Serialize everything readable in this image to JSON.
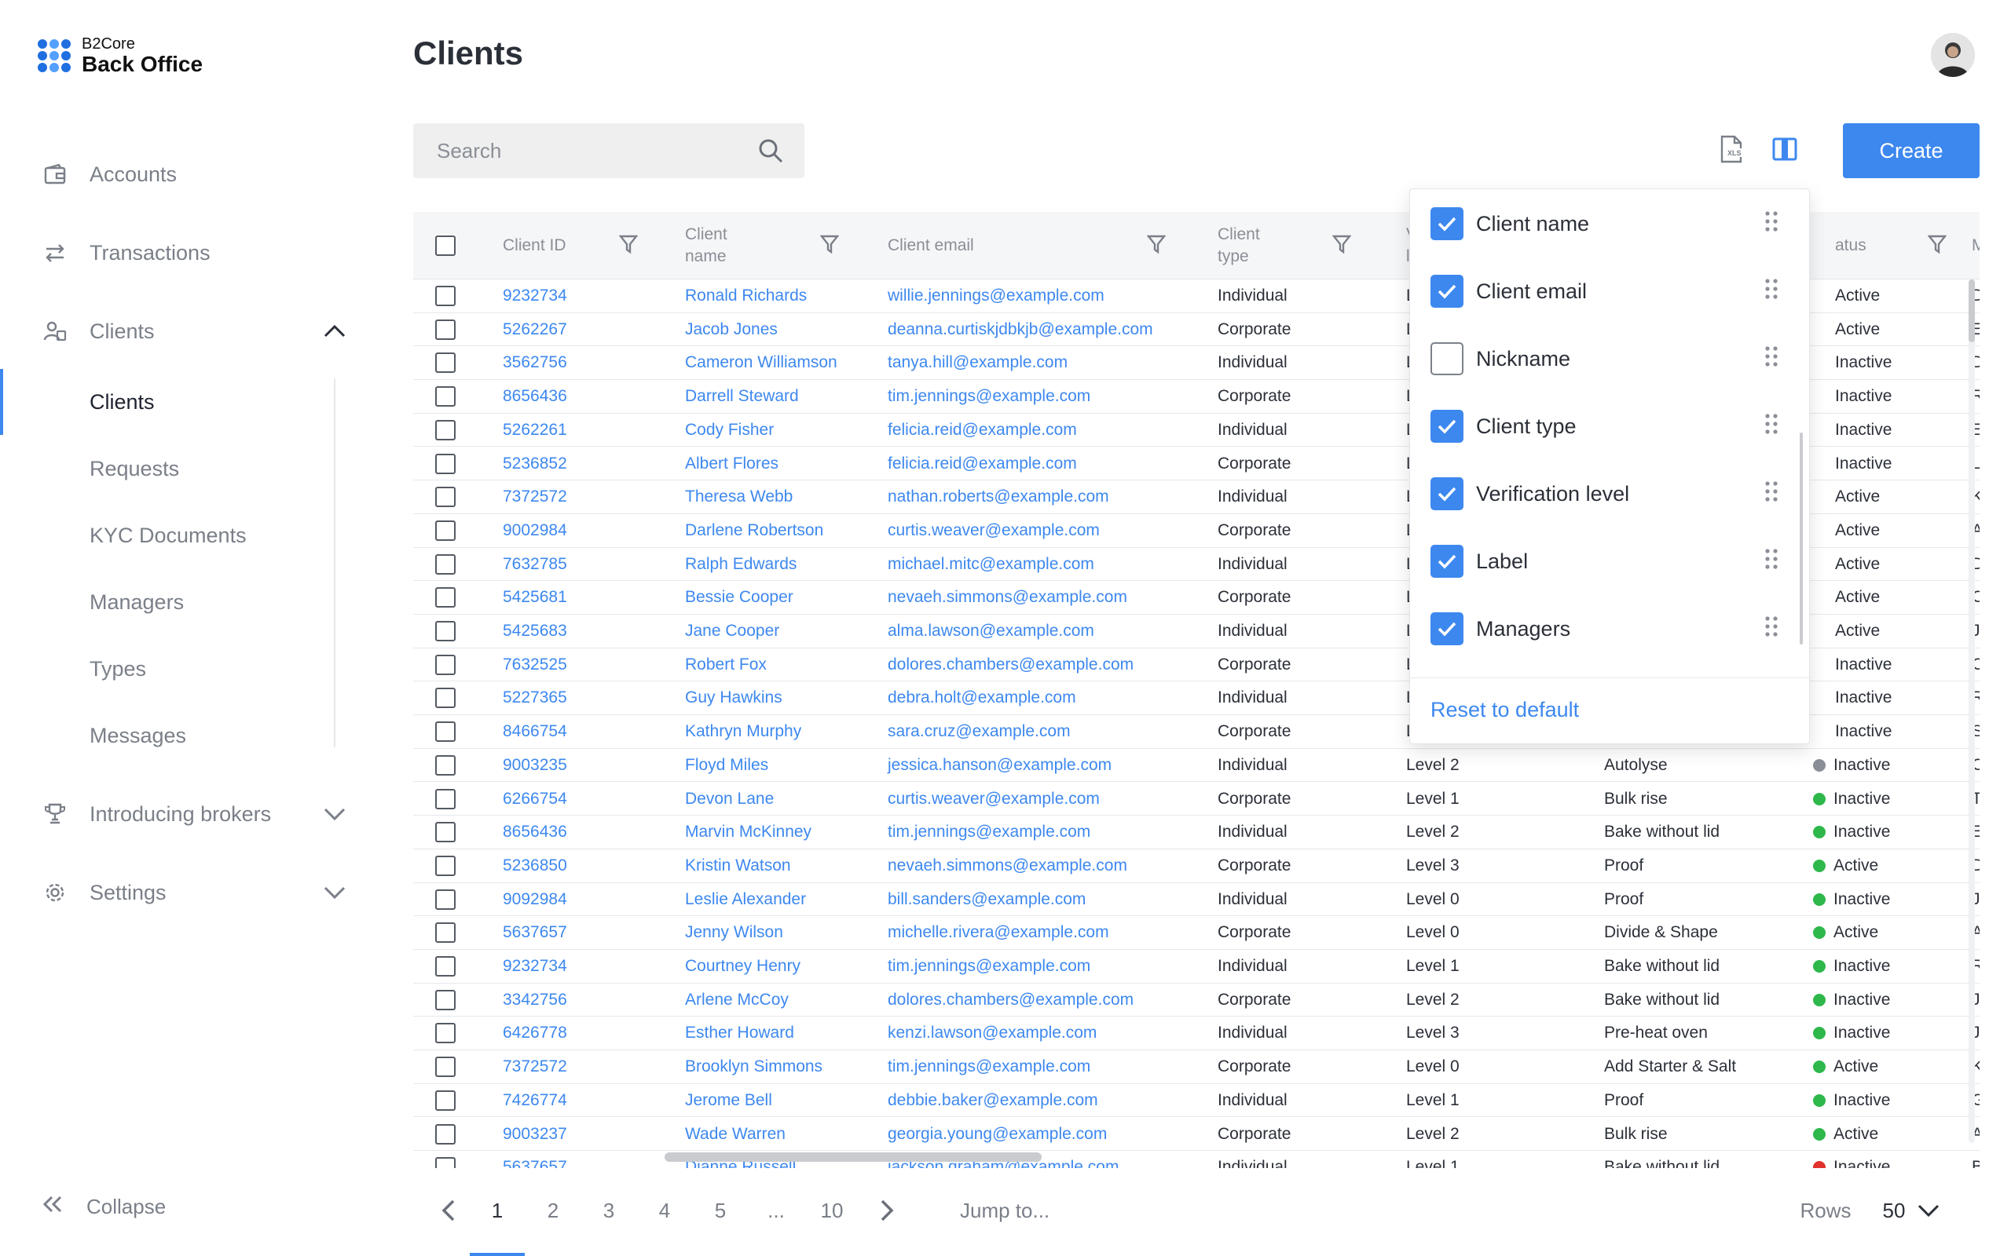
{
  "brand": {
    "line1": "B2Core",
    "line2": "Back Office"
  },
  "sidebar": {
    "nav": [
      {
        "label": "Accounts",
        "icon": "wallet-icon"
      },
      {
        "label": "Transactions",
        "icon": "transfer-arrows-icon"
      },
      {
        "label": "Clients",
        "icon": "users-icon"
      },
      {
        "label": "Introducing brokers",
        "icon": "trophy-icon"
      },
      {
        "label": "Settings",
        "icon": "gear-icon"
      }
    ],
    "clients_sub": [
      "Clients",
      "Requests",
      "KYC Documents",
      "Managers",
      "Types",
      "Messages"
    ],
    "collapse_label": "Collapse"
  },
  "page": {
    "title": "Clients"
  },
  "toolbar": {
    "search_placeholder": "Search",
    "create_label": "Create"
  },
  "table": {
    "headers": {
      "client_id": "Client ID",
      "client_name": [
        "Client",
        "name"
      ],
      "client_email": "Client email",
      "client_type": [
        "Client",
        "type"
      ],
      "verification": [
        "V",
        "le"
      ],
      "status": "atus",
      "managers": "Ma"
    },
    "rows": [
      {
        "id": "9232734",
        "name": "Ronald Richards",
        "email": "willie.jennings@example.com",
        "type": "Individual",
        "level": "L",
        "label": "",
        "status": "Active",
        "mgr": "Da"
      },
      {
        "id": "5262267",
        "name": "Jacob Jones",
        "email": "deanna.curtiskjdbkjb@example.com",
        "type": "Corporate",
        "level": "L",
        "label": "",
        "status": "Active",
        "mgr": "El"
      },
      {
        "id": "3562756",
        "name": "Cameron Williamson",
        "email": "tanya.hill@example.com",
        "type": "Individual",
        "level": "L",
        "label": "",
        "status": "Inactive",
        "mgr": "De"
      },
      {
        "id": "8656436",
        "name": "Darrell Steward",
        "email": "tim.jennings@example.com",
        "type": "Corporate",
        "level": "L",
        "label": "",
        "status": "Inactive",
        "mgr": "Ro"
      },
      {
        "id": "5262261",
        "name": "Cody Fisher",
        "email": "felicia.reid@example.com",
        "type": "Individual",
        "level": "L",
        "label": "",
        "status": "Inactive",
        "mgr": "Ei"
      },
      {
        "id": "5236852",
        "name": "Albert Flores",
        "email": "felicia.reid@example.com",
        "type": "Corporate",
        "level": "L",
        "label": "",
        "status": "Inactive",
        "mgr": "Le"
      },
      {
        "id": "7372572",
        "name": "Theresa Webb",
        "email": "nathan.roberts@example.com",
        "type": "Individual",
        "level": "L",
        "label": "",
        "status": "Active",
        "mgr": "Kr"
      },
      {
        "id": "9002984",
        "name": "Darlene Robertson",
        "email": "curtis.weaver@example.com",
        "type": "Corporate",
        "level": "L",
        "label": "",
        "status": "Active",
        "mgr": "Al"
      },
      {
        "id": "7632785",
        "name": "Ralph Edwards",
        "email": "michael.mitc@example.com",
        "type": "Individual",
        "level": "L",
        "label": "",
        "status": "Active",
        "mgr": "Da"
      },
      {
        "id": "5425681",
        "name": "Bessie Cooper",
        "email": "nevaeh.simmons@example.com",
        "type": "Corporate",
        "level": "L",
        "label": "",
        "status": "Active",
        "mgr": "Ca"
      },
      {
        "id": "5425683",
        "name": "Jane Cooper",
        "email": "alma.lawson@example.com",
        "type": "Individual",
        "level": "L",
        "label": "",
        "status": "Active",
        "mgr": "Je"
      },
      {
        "id": "7632525",
        "name": "Robert Fox",
        "email": "dolores.chambers@example.com",
        "type": "Corporate",
        "level": "L",
        "label": "",
        "status": "Inactive",
        "mgr": "Co"
      },
      {
        "id": "5227365",
        "name": "Guy Hawkins",
        "email": "debra.holt@example.com",
        "type": "Individual",
        "level": "L",
        "label": "",
        "status": "Inactive",
        "mgr": "Ra"
      },
      {
        "id": "8466754",
        "name": "Kathryn Murphy",
        "email": "sara.cruz@example.com",
        "type": "Corporate",
        "level": "L",
        "label": "",
        "status": "Inactive",
        "mgr": "Sa"
      },
      {
        "id": "9003235",
        "name": "Floyd Miles",
        "email": "jessica.hanson@example.com",
        "type": "Individual",
        "level": "Level 2",
        "label": "Autolyse",
        "status": "Inactive",
        "mgr": "Ca",
        "dot": "#8a8e96"
      },
      {
        "id": "6266754",
        "name": "Devon Lane",
        "email": "curtis.weaver@example.com",
        "type": "Corporate",
        "level": "Level 1",
        "label": "Bulk rise",
        "status": "Inactive",
        "mgr": "Th",
        "dot": "#2eb84b"
      },
      {
        "id": "8656436",
        "name": "Marvin McKinney",
        "email": "tim.jennings@example.com",
        "type": "Individual",
        "level": "Level 2",
        "label": "Bake without lid",
        "status": "Inactive",
        "mgr": "Es",
        "dot": "#2eb84b"
      },
      {
        "id": "5236850",
        "name": "Kristin Watson",
        "email": "nevaeh.simmons@example.com",
        "type": "Corporate",
        "level": "Level 3",
        "label": "Proof",
        "status": "Active",
        "mgr": "Di",
        "dot": "#2eb84b"
      },
      {
        "id": "9092984",
        "name": "Leslie Alexander",
        "email": "bill.sanders@example.com",
        "type": "Individual",
        "level": "Level 0",
        "label": "Proof",
        "status": "Inactive",
        "mgr": "Ja",
        "dot": "#2eb84b"
      },
      {
        "id": "5637657",
        "name": "Jenny Wilson",
        "email": "michelle.rivera@example.com",
        "type": "Corporate",
        "level": "Level 0",
        "label": "Divide & Shape",
        "status": "Active",
        "mgr": "Ar",
        "dot": "#2eb84b"
      },
      {
        "id": "9232734",
        "name": "Courtney Henry",
        "email": "tim.jennings@example.com",
        "type": "Individual",
        "level": "Level 1",
        "label": "Bake without lid",
        "status": "Inactive",
        "mgr": "Ro",
        "dot": "#2eb84b"
      },
      {
        "id": "3342756",
        "name": "Arlene McCoy",
        "email": "dolores.chambers@example.com",
        "type": "Corporate",
        "level": "Level 2",
        "label": "Bake without lid",
        "status": "Inactive",
        "mgr": "Je",
        "dot": "#2eb84b"
      },
      {
        "id": "6426778",
        "name": "Esther Howard",
        "email": "kenzi.lawson@example.com",
        "type": "Individual",
        "level": "Level 3",
        "label": "Pre-heat oven",
        "status": "Inactive",
        "mgr": "Ja",
        "dot": "#2eb84b"
      },
      {
        "id": "7372572",
        "name": "Brooklyn Simmons",
        "email": "tim.jennings@example.com",
        "type": "Corporate",
        "level": "Level 0",
        "label": "Add Starter & Salt",
        "status": "Active",
        "mgr": "Ka",
        "dot": "#2eb84b"
      },
      {
        "id": "7426774",
        "name": "Jerome Bell",
        "email": "debbie.baker@example.com",
        "type": "Individual",
        "level": "Level 1",
        "label": "Proof",
        "status": "Inactive",
        "mgr": "Gu",
        "dot": "#2eb84b"
      },
      {
        "id": "9003237",
        "name": "Wade Warren",
        "email": "georgia.young@example.com",
        "type": "Corporate",
        "level": "Level 2",
        "label": "Bulk rise",
        "status": "Active",
        "mgr": "Ar",
        "dot": "#2eb84b"
      },
      {
        "id": "5637657",
        "name": "Dianne Russell",
        "email": "jackson.graham@example.com",
        "type": "Individual",
        "level": "Level 1",
        "label": "Bake without lid",
        "status": "Inactive",
        "mgr": "Bo",
        "dot": "#e0322d"
      }
    ]
  },
  "columns_popup": {
    "items": [
      {
        "label": "Client name",
        "checked": true
      },
      {
        "label": "Client email",
        "checked": true
      },
      {
        "label": "Nickname",
        "checked": false
      },
      {
        "label": "Client type",
        "checked": true
      },
      {
        "label": "Verification level",
        "checked": true
      },
      {
        "label": "Label",
        "checked": true
      },
      {
        "label": "Managers",
        "checked": true
      }
    ],
    "reset_label": "Reset to default"
  },
  "pagination": {
    "pages": [
      "1",
      "2",
      "3",
      "4",
      "5",
      "...",
      "10"
    ],
    "current": "1",
    "jump_placeholder": "Jump to...",
    "rows_label": "Rows",
    "rows_value": "50"
  },
  "colors": {
    "accent": "#3d88ef",
    "status_active": "#2eb84b",
    "status_neutral": "#8a8e96",
    "status_error": "#e0322d"
  }
}
